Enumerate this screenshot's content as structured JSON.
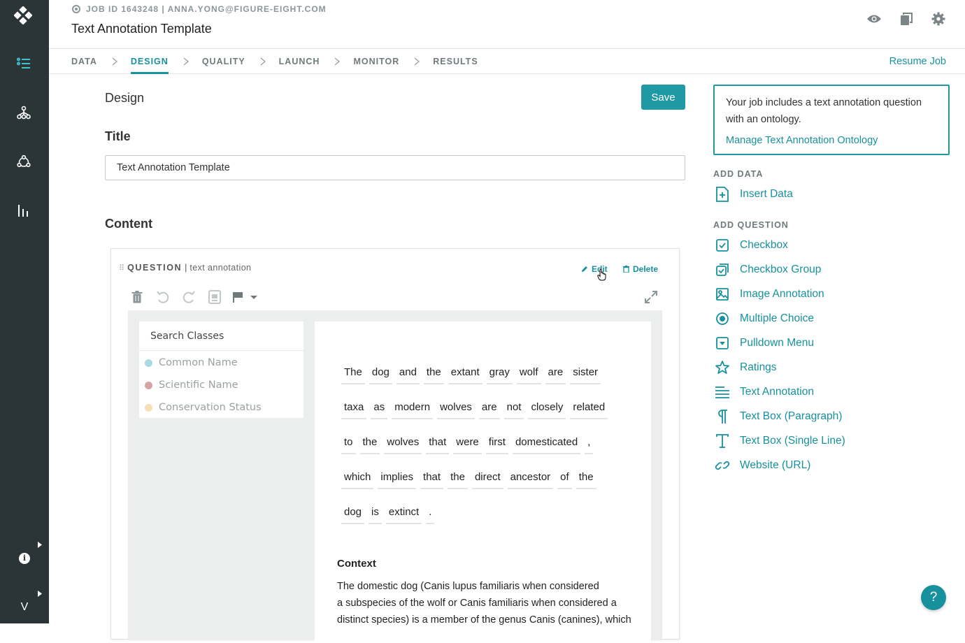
{
  "header": {
    "job_meta": "JOB ID 1643248 | ANNA.YONG@FIGURE-EIGHT.COM",
    "title": "Text Annotation Template"
  },
  "steps": [
    "DATA",
    "DESIGN",
    "QUALITY",
    "LAUNCH",
    "MONITOR",
    "RESULTS"
  ],
  "active_step": "DESIGN",
  "resume_label": "Resume Job",
  "design": {
    "heading": "Design",
    "save_label": "Save",
    "title_label": "Title",
    "title_value": "Text Annotation Template",
    "content_label": "Content"
  },
  "question": {
    "type_label": "QUESTION",
    "separator": "|",
    "kind": "text annotation",
    "edit_label": "Edit",
    "delete_label": "Delete",
    "search_placeholder": "Search Classes",
    "classes": [
      {
        "name": "Common Name",
        "color": "#a9d9e4"
      },
      {
        "name": "Scientific Name",
        "color": "#d6a3a1"
      },
      {
        "name": "Conservation Status",
        "color": "#f7e0b5"
      }
    ],
    "token_lines": [
      [
        "The",
        "dog",
        "and",
        "the",
        "extant",
        "gray",
        "wolf",
        "are",
        "sister"
      ],
      [
        "taxa",
        "as",
        "modern",
        "wolves",
        "are",
        "not",
        "closely",
        "related"
      ],
      [
        "to",
        "the",
        "wolves",
        "that",
        "were",
        "first",
        "domesticated",
        ","
      ],
      [
        "which",
        "implies",
        "that",
        "the",
        "direct",
        "ancestor",
        "of",
        "the"
      ],
      [
        "dog",
        "is",
        "extinct",
        "."
      ]
    ],
    "context_title": "Context",
    "context_lines": [
      "The domestic dog (Canis lupus familiaris when considered",
      "a subspecies of the wolf or Canis familiaris when considered a",
      "distinct species) is a member of the genus Canis (canines), which"
    ]
  },
  "sidebar": {
    "notice_text": "Your job includes a text annotation question with an ontology.",
    "notice_link": "Manage Text Annotation Ontology",
    "add_data_title": "ADD DATA",
    "insert_data": "Insert Data",
    "add_question_title": "ADD QUESTION",
    "question_types": [
      {
        "label": "Checkbox",
        "icon": "checkbox-icon"
      },
      {
        "label": "Checkbox Group",
        "icon": "checkbox-group-icon"
      },
      {
        "label": "Image Annotation",
        "icon": "image-icon"
      },
      {
        "label": "Multiple Choice",
        "icon": "radio-icon"
      },
      {
        "label": "Pulldown Menu",
        "icon": "pulldown-icon"
      },
      {
        "label": "Ratings",
        "icon": "star-icon"
      },
      {
        "label": "Text Annotation",
        "icon": "text-lines-icon"
      },
      {
        "label": "Text Box (Paragraph)",
        "icon": "pilcrow-icon"
      },
      {
        "label": "Text Box (Single Line)",
        "icon": "text-t-icon"
      },
      {
        "label": "Website (URL)",
        "icon": "link-icon"
      }
    ]
  },
  "help_label": "?",
  "avatar_label": "V",
  "info_label": "i",
  "colors": {
    "accent": "#17919d",
    "rail": "#2b3538"
  }
}
